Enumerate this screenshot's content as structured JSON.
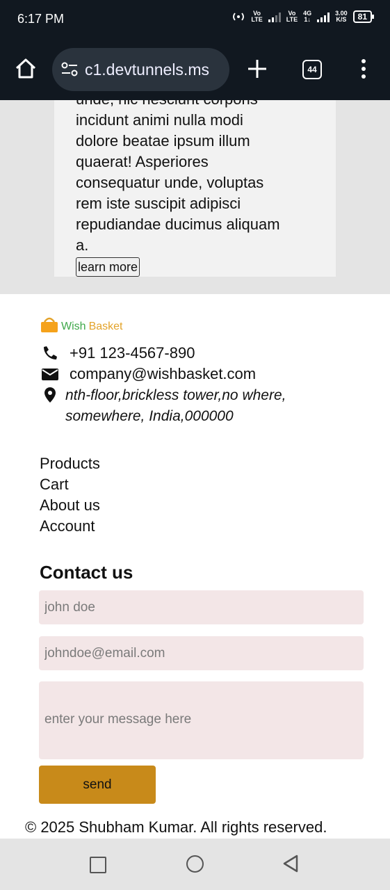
{
  "status_bar": {
    "time": "6:17 PM",
    "sim1_label_top": "Vo",
    "sim1_label_bottom": "LTE",
    "sim2_label_top": "Vo",
    "sim2_label_bottom": "LTE",
    "network_top": "4G",
    "network_bottom": "1↓",
    "speed_top": "3.00",
    "speed_bottom": "K/S",
    "battery": "81"
  },
  "browser": {
    "url": "c1.devtunnels.ms",
    "tab_count": "44",
    "icons": {
      "home": "home-icon",
      "site_settings": "tune-icon",
      "new_tab": "plus-icon",
      "menu": "more-vertical-icon"
    }
  },
  "card": {
    "lines": [
      "unde, nic nesciunt corporis",
      "incidunt animi nulla modi",
      "dolore beatae ipsum illum",
      "quaerat! Asperiores",
      "consequatur unde, voluptas",
      "rem iste suscipit adipisci",
      "repudiandae ducimus aliquam",
      "a."
    ],
    "button_label": "learn more"
  },
  "footer": {
    "brand_wish": "Wish",
    "brand_basket": "Basket",
    "phone": "+91 123-4567-890",
    "email": "company@wishbasket.com",
    "address_line1": "nth-floor,brickless tower,no where,",
    "address_line2": "somewhere, India,000000",
    "links": [
      "Products",
      "Cart",
      "About us",
      "Account"
    ],
    "contact_title": "Contact us",
    "name_placeholder": "john doe",
    "email_placeholder": "johndoe@email.com",
    "message_placeholder": "enter your message here",
    "send_label": "send",
    "copyright": "© 2025 Shubham Kumar. All rights reserved.",
    "colors": {
      "brand_wish": "#3fa84a",
      "brand_basket": "#e3a32a",
      "send_button": "#c88a1a",
      "input_bg": "#f3e6e7"
    }
  },
  "system_nav": {
    "icons": [
      "recents-square-icon",
      "home-circle-icon",
      "back-triangle-icon"
    ]
  }
}
